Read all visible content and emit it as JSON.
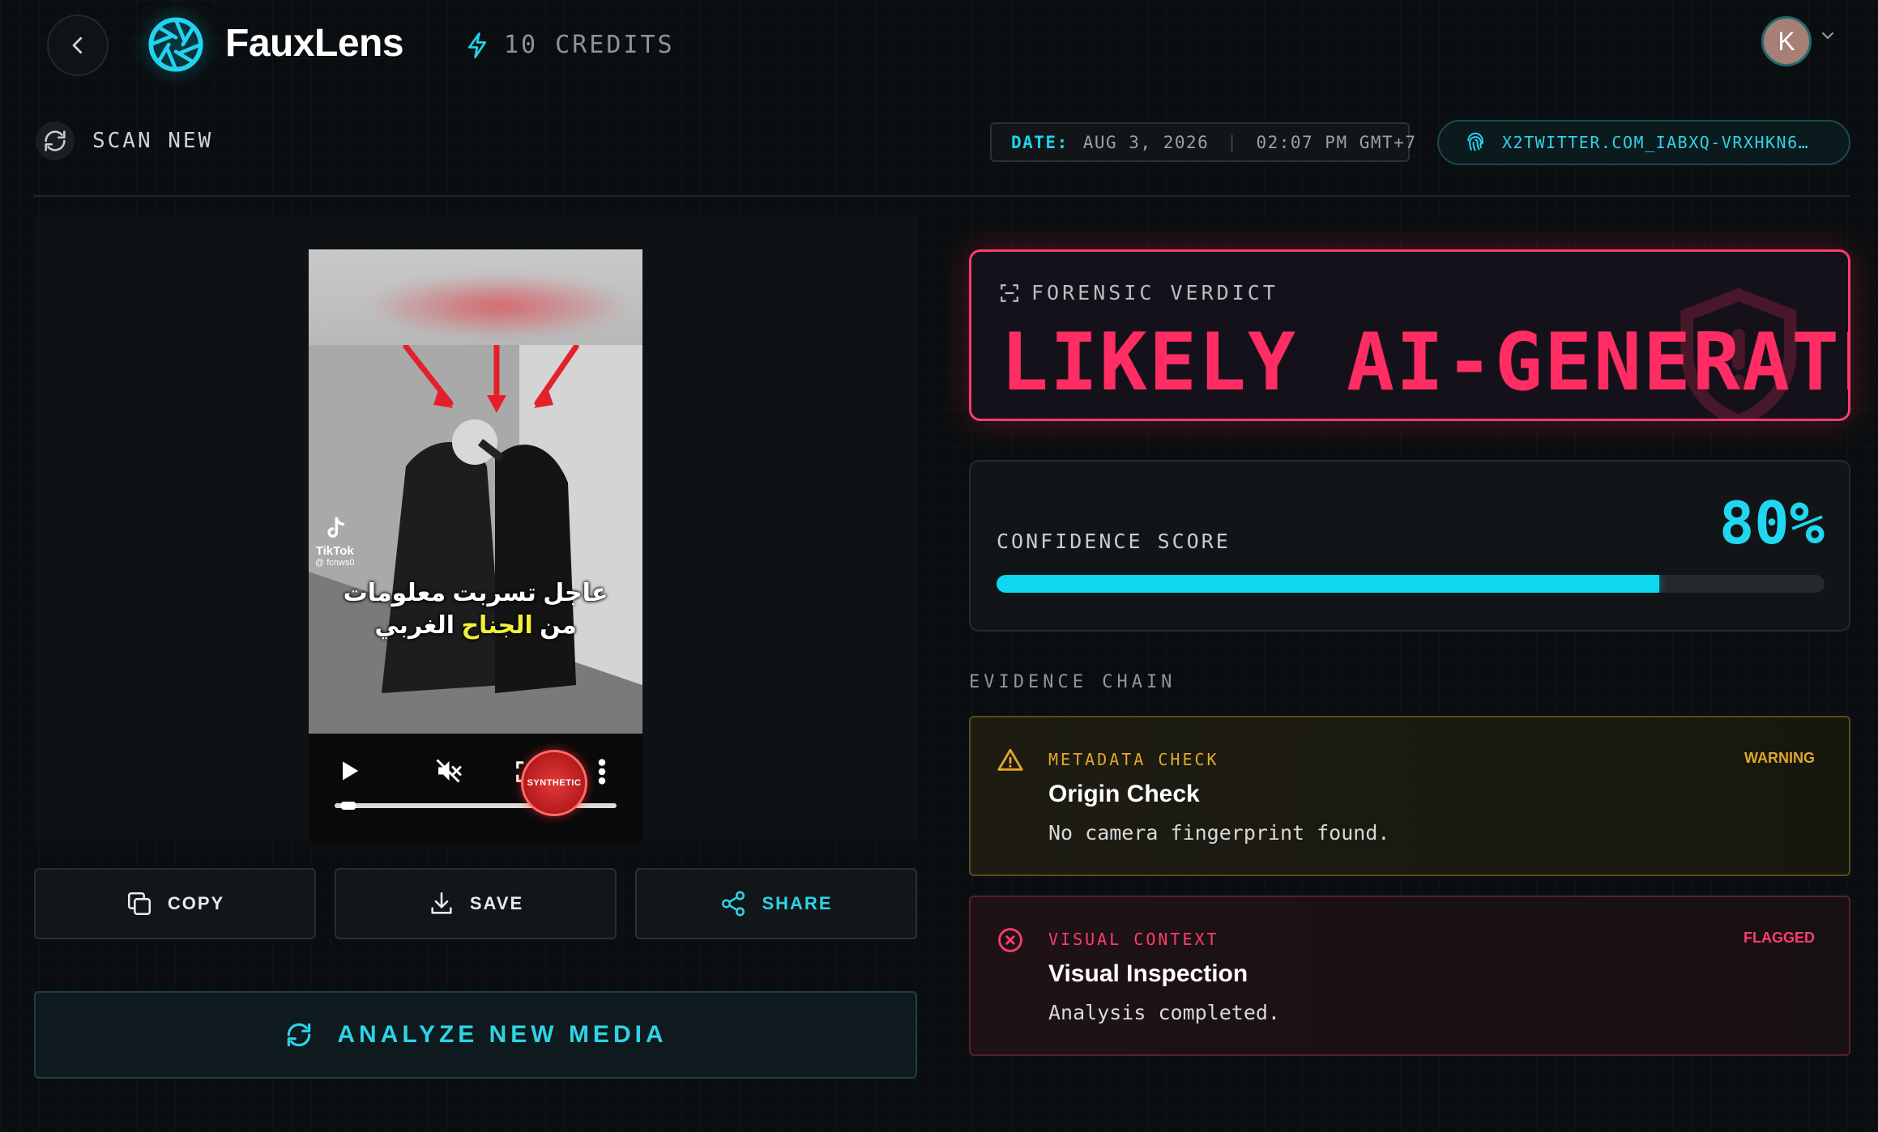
{
  "header": {
    "brand": "FauxLens",
    "credits": "10 CREDITS",
    "avatar_initial": "K"
  },
  "subheader": {
    "scan_new": "SCAN NEW",
    "date_label": "DATE:",
    "date": "AUG 3, 2026",
    "time": "02:07 PM GMT+7",
    "source_url": "X2TWITTER.COM_IABXQ-VRXHKN6…"
  },
  "media": {
    "tiktok_label": "TikTok",
    "tiktok_handle": "@ fcnws0",
    "caption_line1": "عاجل تسربت معلومات",
    "caption_line2_a": "من ",
    "caption_line2_highlight": "الجناح",
    "caption_line2_b": " الغربي",
    "stamp": "SYNTHETIC",
    "playback_progress": 0.05
  },
  "actions": {
    "copy": "COPY",
    "save": "SAVE",
    "share": "SHARE",
    "analyze": "ANALYZE NEW MEDIA"
  },
  "verdict": {
    "label": "FORENSIC VERDICT",
    "value": "LIKELY AI-GENERATED",
    "color": "#ff2d63"
  },
  "confidence": {
    "label": "CONFIDENCE SCORE",
    "value_text": "80%",
    "value": 0.8,
    "color": "#0ed8f0"
  },
  "evidence": {
    "title": "EVIDENCE CHAIN",
    "items": [
      {
        "category": "METADATA CHECK",
        "status": "WARNING",
        "title": "Origin Check",
        "description": "No camera fingerprint found.",
        "color": "#e0a82a",
        "icon": "warning-triangle-icon"
      },
      {
        "category": "VISUAL CONTEXT",
        "status": "FLAGGED",
        "title": "Visual Inspection",
        "description": "Analysis completed.",
        "color": "#ff3d6a",
        "icon": "x-circle-icon"
      }
    ]
  }
}
